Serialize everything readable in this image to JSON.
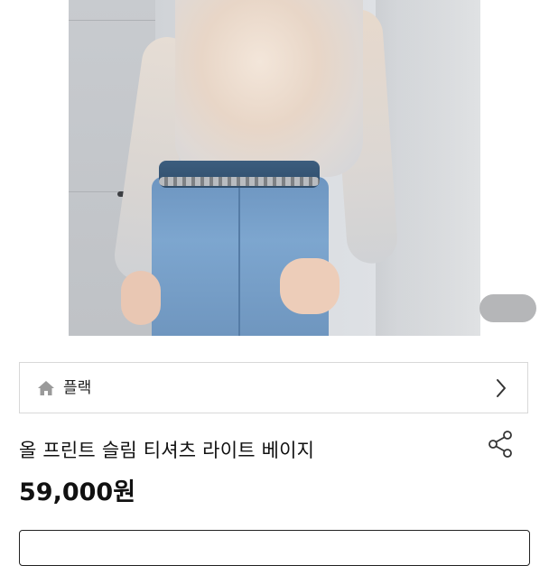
{
  "product": {
    "category": "플랙",
    "title": "올 프린트 슬림 티셔츠 라이트 베이지",
    "price": "59,000원"
  },
  "icons": {
    "home": "home-icon",
    "chevron": "chevron-right-icon",
    "share": "share-icon"
  },
  "colors": {
    "text": "#111111",
    "border": "#d8d8d8",
    "pager": "#b5b6b8"
  }
}
